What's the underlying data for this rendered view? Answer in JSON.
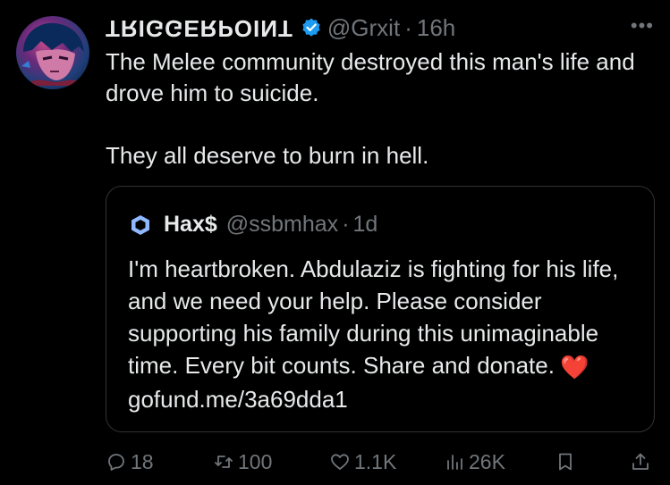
{
  "tweet": {
    "author": {
      "display_name": "TRIGGERPOINT",
      "handle": "@Grxit",
      "time": "16h",
      "separator": "·",
      "verified": true
    },
    "more_label": "•••",
    "text_lines": [
      "The Melee community destroyed this man's life and drove him to suicide.",
      "They all deserve to burn in hell."
    ],
    "quote": {
      "display_name": "Hax$",
      "handle": "@ssbmhax",
      "separator": "·",
      "time": "1d",
      "text": "I'm heartbroken. Abdulaziz is fighting for his life, and we need your help. Please consider supporting his family during this unimaginable time. Every bit counts. Share and donate.",
      "emoji": "❤️",
      "link": "gofund.me/3a69dda1"
    },
    "actions": {
      "replies": "18",
      "retweets": "100",
      "likes": "1.1K",
      "views": "26K"
    }
  },
  "colors": {
    "background": "#000000",
    "text": "#e7e9ea",
    "muted": "#71767b",
    "border": "#2f3336",
    "verified": "#1d9bf0",
    "heart": "#e8202a"
  },
  "icons": [
    "avatar",
    "verified-badge-icon",
    "more-icon",
    "quote-avatar-icon",
    "reply-icon",
    "retweet-icon",
    "like-icon",
    "views-icon",
    "bookmark-icon",
    "share-icon"
  ]
}
